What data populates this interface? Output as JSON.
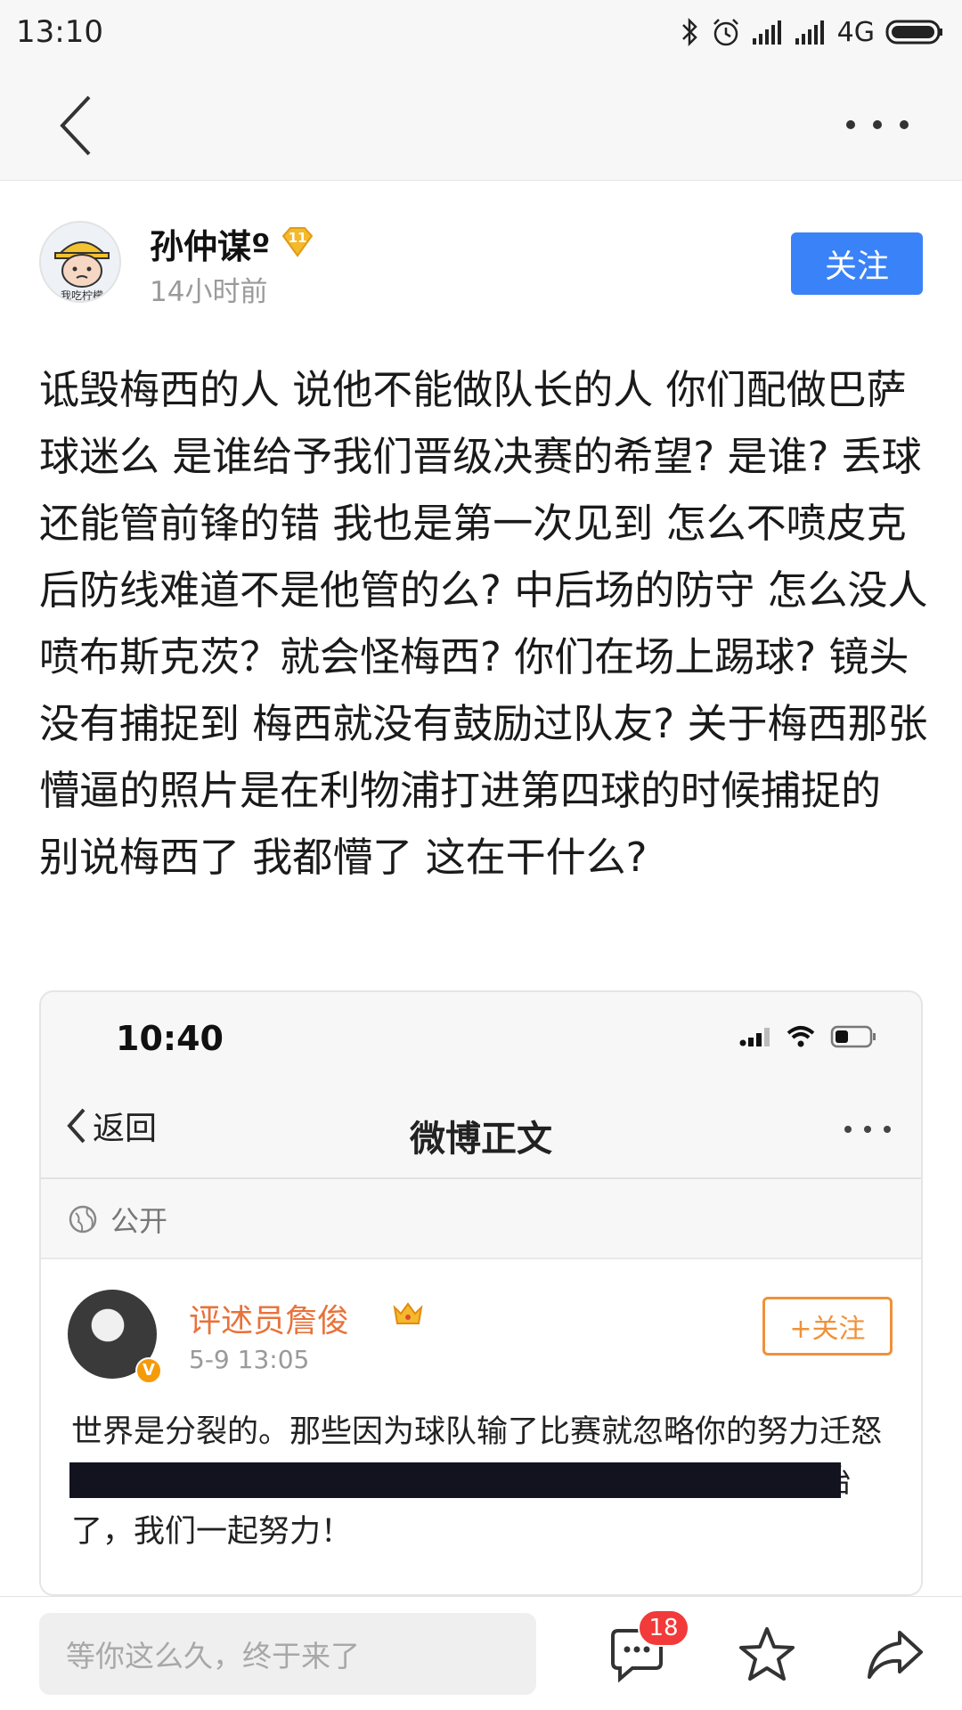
{
  "status_bar": {
    "time": "13:10",
    "network": "4G"
  },
  "post": {
    "author_name": "孙仲谋º",
    "level": "11",
    "avatar_caption": "我吃柠檬",
    "time_ago": "14小时前",
    "follow_label": "关注",
    "text": "诋毁梅西的人 说他不能做队长的人 你们配做巴萨球迷么 是谁给予我们晋级决赛的希望? 是谁? 丢球还能管前锋的错 我也是第一次见到 怎么不喷皮克后防线难道不是他管的么? 中后场的防守 怎么没人喷布斯克茨？就会怪梅西? 你们在场上踢球? 镜头没有捕捉到 梅西就没有鼓励过队友? 关于梅西那张懵逼的照片是在利物浦打进第四球的时候捕捉的 别说梅西了 我都懵了 这在干什么?"
  },
  "embedded_screenshot": {
    "time": "10:40",
    "back_label": "返回",
    "title": "微博正文",
    "visibility": "公开",
    "user_name": "评述员詹俊",
    "verified_mark": "V",
    "date": "5-9 13:05",
    "follow_label": "+关注",
    "text": "世界是分裂的。那些因为球队输了比赛就忽略你的努力迁怒于你的人，不配像你一样热爱这项运动。新的一天又开始了，我们一起努力！"
  },
  "bottom_bar": {
    "comment_placeholder": "等你这么久，终于来了",
    "comment_count": "18"
  },
  "colors": {
    "accent_blue": "#3a82f7",
    "weibo_orange": "#f0913a",
    "badge_red": "#f23a3a",
    "level_gold": "#f4b92c"
  }
}
